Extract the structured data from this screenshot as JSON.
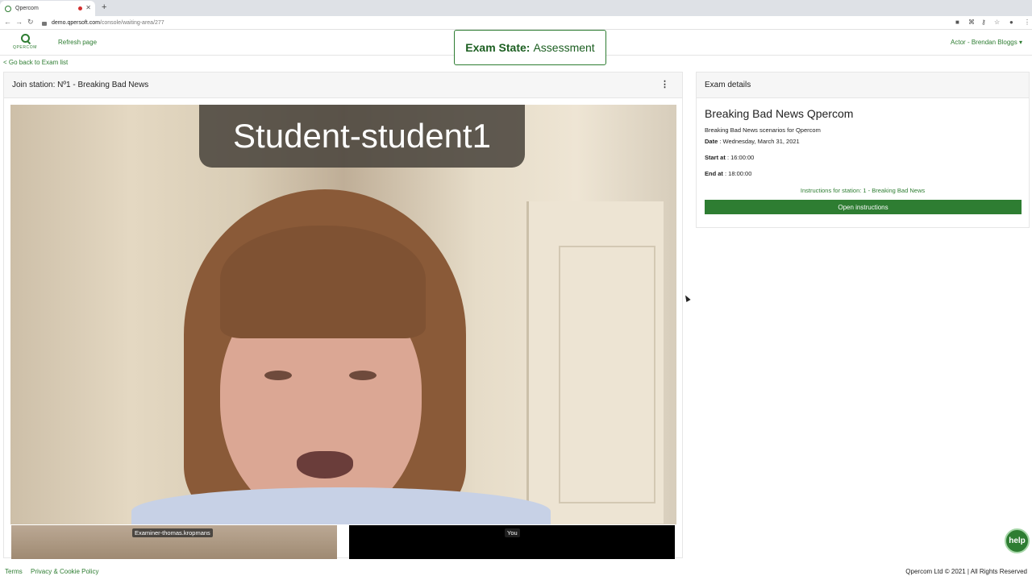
{
  "browser": {
    "tab_title": "Qpercom",
    "url_host": "demo.qpersoft.com",
    "url_path": "/console/waiting-area/277"
  },
  "header": {
    "logo_text": "QPERCOM",
    "refresh_label": "Refresh page",
    "exam_state_label": "Exam State:",
    "exam_state_value": "Assessment",
    "actor_label": "Actor - Brendan Bloggs ▾"
  },
  "nav": {
    "back_label": "< Go back to Exam list"
  },
  "station": {
    "title": "Join station: Nº1 - Breaking Bad News",
    "video_name_banner": "Student-student1",
    "thumbnails": [
      {
        "label": "Examiner-thomas.kropmans"
      },
      {
        "label": "You"
      }
    ]
  },
  "details": {
    "header": "Exam details",
    "exam_title": "Breaking Bad News Qpercom",
    "description": "Breaking Bad News scenarios for Qpercom",
    "date_label": "Date",
    "date_value": ": Wednesday, March 31, 2021",
    "start_label": "Start at",
    "start_value": ": 16:00:00",
    "end_label": "End at",
    "end_value": ": 18:00:00",
    "instructions_label": "Instructions for station: 1 - Breaking Bad News",
    "open_button": "Open instructions"
  },
  "help_label": "help",
  "footer": {
    "terms": "Terms",
    "privacy": "Privacy & Cookie Policy",
    "copyright": "Qpercom Ltd © 2021 | All Rights Reserved"
  },
  "colors": {
    "accent": "#2e7d32"
  }
}
